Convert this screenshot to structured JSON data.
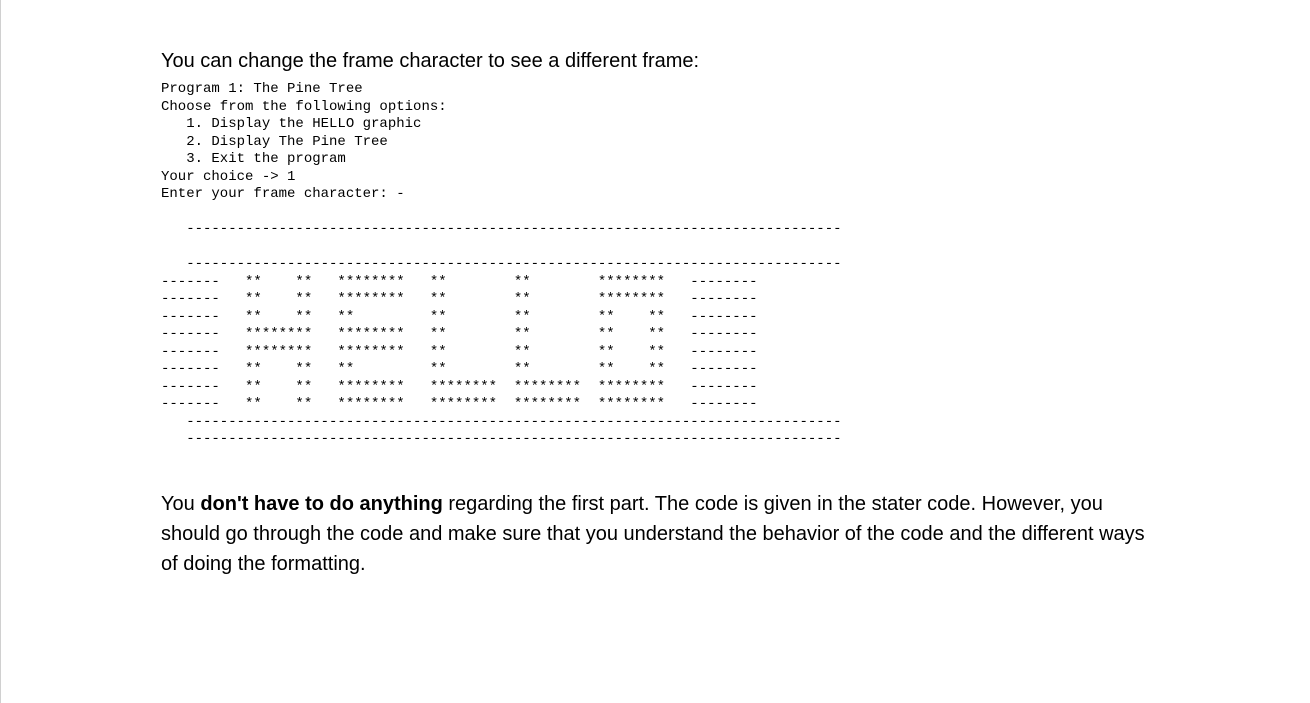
{
  "intro": "You can change the frame character to see a different frame:",
  "terminal": "Program 1: The Pine Tree\nChoose from the following options:\n   1. Display the HELLO graphic\n   2. Display The Pine Tree\n   3. Exit the program\nYour choice -> 1\nEnter your frame character: -\n\n   ------------------------------------------------------------------------------\n\n   ------------------------------------------------------------------------------\n-------   **    **   ********   **        **        ********   --------\n-------   **    **   ********   **        **        ********   --------\n-------   **    **   **         **        **        **    **   --------\n-------   ********   ********   **        **        **    **   --------\n-------   ********   ********   **        **        **    **   --------\n-------   **    **   **         **        **        **    **   --------\n-------   **    **   ********   ********  ********  ********   --------\n-------   **    **   ********   ********  ********  ********   --------\n   ------------------------------------------------------------------------------\n   ------------------------------------------------------------------------------",
  "body": {
    "prefix": "You ",
    "bold": "don't have to do anything",
    "suffix": " regarding the first part. The code is given in the stater code. However, you should go through the code and make sure that you understand the behavior of the code and the different ways of doing the formatting."
  }
}
